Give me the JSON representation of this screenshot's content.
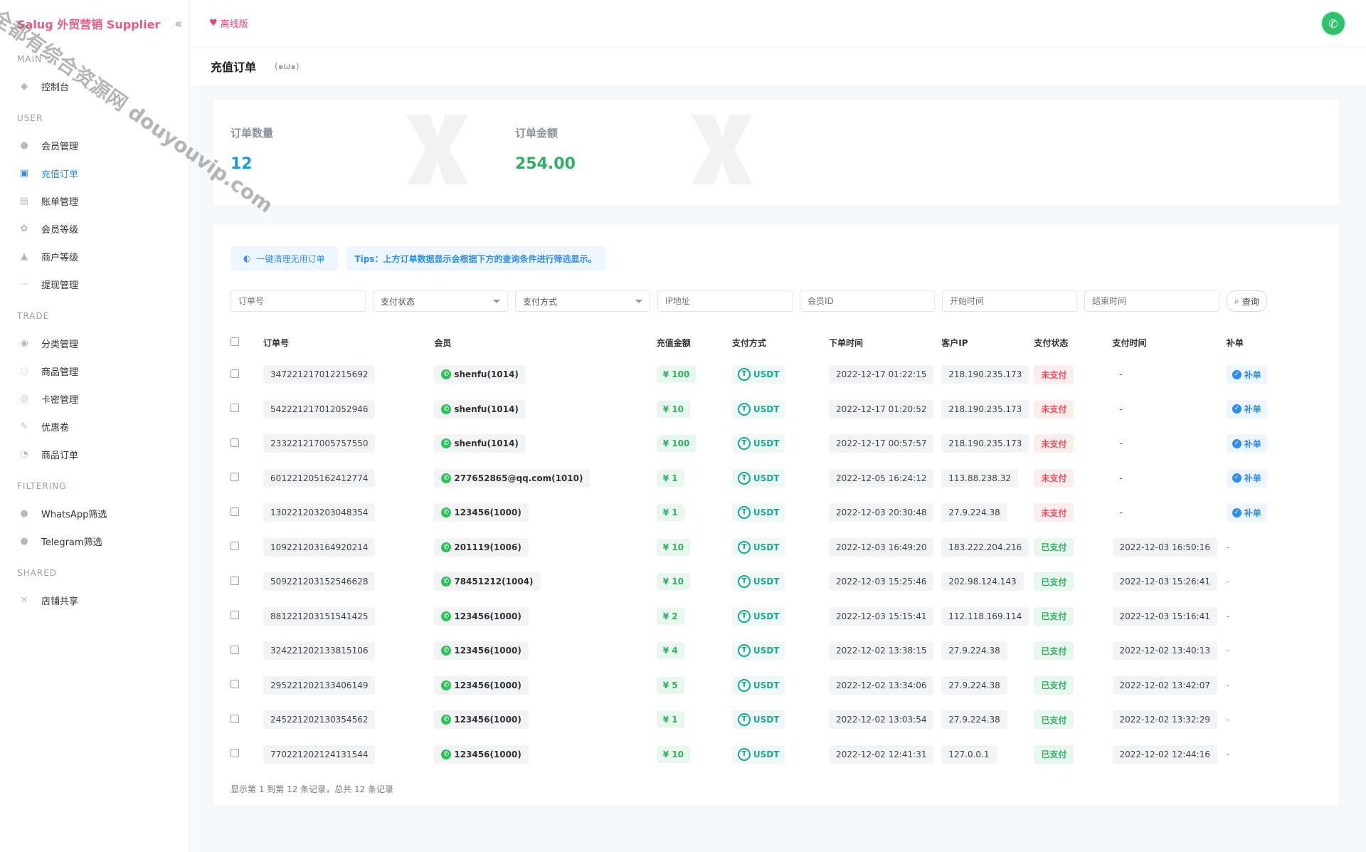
{
  "sidebar": {
    "brand": "Salug 外贸营销 Supplier",
    "watermark": "全都有综合资源网 douyouvip.com",
    "sections": [
      {
        "title": "MAIN",
        "items": [
          {
            "label": "控制台",
            "icon": "dashboard-icon"
          }
        ]
      },
      {
        "title": "USER",
        "items": [
          {
            "label": "会员管理",
            "icon": "user-icon"
          },
          {
            "label": "充值订单",
            "icon": "recharge-icon",
            "active": true
          },
          {
            "label": "账单管理",
            "icon": "bill-icon"
          },
          {
            "label": "会员等级",
            "icon": "level-icon"
          },
          {
            "label": "商户等级",
            "icon": "merchant-icon"
          },
          {
            "label": "提现管理",
            "icon": "withdraw-icon"
          }
        ]
      },
      {
        "title": "TRADE",
        "items": [
          {
            "label": "分类管理",
            "icon": "category-icon"
          },
          {
            "label": "商品管理",
            "icon": "goods-icon"
          },
          {
            "label": "卡密管理",
            "icon": "card-icon"
          },
          {
            "label": "优惠卷",
            "icon": "coupon-icon"
          },
          {
            "label": "商品订单",
            "icon": "order-icon"
          }
        ]
      },
      {
        "title": "FILTERING",
        "items": [
          {
            "label": "WhatsApp筛选",
            "icon": "whatsapp-icon"
          },
          {
            "label": "Telegram筛选",
            "icon": "telegram-icon"
          }
        ]
      },
      {
        "title": "SHARED",
        "items": [
          {
            "label": "店铺共享",
            "icon": "share-icon"
          }
        ]
      }
    ]
  },
  "topbar": {
    "offline_label": "离线版"
  },
  "page": {
    "title": "充值订单",
    "subtitle": "(๑ω๑)"
  },
  "stats": [
    {
      "label": "订单数量",
      "value": "12",
      "color": "#1a9be0"
    },
    {
      "label": "订单金额",
      "value": "254.00",
      "color": "#2fb062"
    }
  ],
  "toolbar": {
    "clean_label": "一键清理无用订单",
    "tips": "Tips：上方订单数据显示会根据下方的查询条件进行筛选显示。"
  },
  "filters": {
    "order_no": "订单号",
    "pay_status": "支付状态",
    "pay_method": "支付方式",
    "ip": "IP地址",
    "member_id": "会员ID",
    "start_time": "开始时间",
    "end_time": "结束时间",
    "search_label": "查询"
  },
  "table": {
    "headers": [
      "订单号",
      "会员",
      "充值金额",
      "支付方式",
      "下单时间",
      "客户IP",
      "支付状态",
      "支付时间",
      "补单"
    ],
    "fix_label": "补单",
    "rows": [
      {
        "order": "347221217012215692",
        "member": "shenfu(1014)",
        "amount": "¥ 100",
        "method": "USDT",
        "created": "2022-12-17 01:22:15",
        "ip": "218.190.235.173",
        "status": "未支付",
        "paid": false,
        "pay_time": "-",
        "fix": true
      },
      {
        "order": "542221217012052946",
        "member": "shenfu(1014)",
        "amount": "¥ 10",
        "method": "USDT",
        "created": "2022-12-17 01:20:52",
        "ip": "218.190.235.173",
        "status": "未支付",
        "paid": false,
        "pay_time": "-",
        "fix": true
      },
      {
        "order": "233221217005757550",
        "member": "shenfu(1014)",
        "amount": "¥ 100",
        "method": "USDT",
        "created": "2022-12-17 00:57:57",
        "ip": "218.190.235.173",
        "status": "未支付",
        "paid": false,
        "pay_time": "-",
        "fix": true
      },
      {
        "order": "601221205162412774",
        "member": "277652865@qq.com(1010)",
        "amount": "¥ 1",
        "method": "USDT",
        "created": "2022-12-05 16:24:12",
        "ip": "113.88.238.32",
        "status": "未支付",
        "paid": false,
        "pay_time": "-",
        "fix": true
      },
      {
        "order": "130221203203048354",
        "member": "123456(1000)",
        "amount": "¥ 1",
        "method": "USDT",
        "created": "2022-12-03 20:30:48",
        "ip": "27.9.224.38",
        "status": "未支付",
        "paid": false,
        "pay_time": "-",
        "fix": true
      },
      {
        "order": "109221203164920214",
        "member": "201119(1006)",
        "amount": "¥ 10",
        "method": "USDT",
        "created": "2022-12-03 16:49:20",
        "ip": "183.222.204.216",
        "status": "已支付",
        "paid": true,
        "pay_time": "2022-12-03 16:50:16",
        "fix": false
      },
      {
        "order": "509221203152546628",
        "member": "78451212(1004)",
        "amount": "¥ 10",
        "method": "USDT",
        "created": "2022-12-03 15:25:46",
        "ip": "202.98.124.143",
        "status": "已支付",
        "paid": true,
        "pay_time": "2022-12-03 15:26:41",
        "fix": false
      },
      {
        "order": "881221203151541425",
        "member": "123456(1000)",
        "amount": "¥ 2",
        "method": "USDT",
        "created": "2022-12-03 15:15:41",
        "ip": "112.118.169.114",
        "status": "已支付",
        "paid": true,
        "pay_time": "2022-12-03 15:16:41",
        "fix": false
      },
      {
        "order": "324221202133815106",
        "member": "123456(1000)",
        "amount": "¥ 4",
        "method": "USDT",
        "created": "2022-12-02 13:38:15",
        "ip": "27.9.224.38",
        "status": "已支付",
        "paid": true,
        "pay_time": "2022-12-02 13:40:13",
        "fix": false
      },
      {
        "order": "295221202133406149",
        "member": "123456(1000)",
        "amount": "¥ 5",
        "method": "USDT",
        "created": "2022-12-02 13:34:06",
        "ip": "27.9.224.38",
        "status": "已支付",
        "paid": true,
        "pay_time": "2022-12-02 13:42:07",
        "fix": false
      },
      {
        "order": "245221202130354562",
        "member": "123456(1000)",
        "amount": "¥ 1",
        "method": "USDT",
        "created": "2022-12-02 13:03:54",
        "ip": "27.9.224.38",
        "status": "已支付",
        "paid": true,
        "pay_time": "2022-12-02 13:32:29",
        "fix": false
      },
      {
        "order": "770221202124131544",
        "member": "123456(1000)",
        "amount": "¥ 10",
        "method": "USDT",
        "created": "2022-12-02 12:41:31",
        "ip": "127.0.0.1",
        "status": "已支付",
        "paid": true,
        "pay_time": "2022-12-02 12:44:16",
        "fix": false
      }
    ]
  },
  "footer": {
    "info": "显示第 1 到第 12 条记录，总共 12 条记录"
  }
}
